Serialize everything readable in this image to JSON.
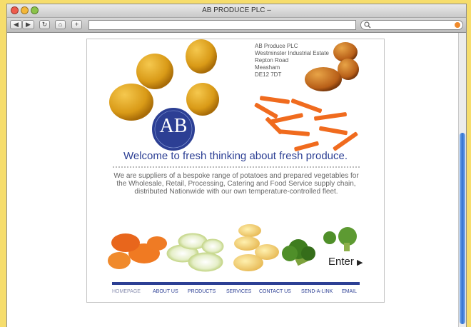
{
  "window": {
    "title": "AB PRODUCE PLC –",
    "url": "",
    "search_placeholder": ""
  },
  "toolbar": {
    "back": "◀",
    "forward": "▶",
    "reload": "↻",
    "home": "⌂",
    "add": "+",
    "search_icon": "search-icon"
  },
  "page": {
    "address": [
      "AB Produce PLC",
      "Westminster Industrial Estate",
      "Repton Road",
      "Measham",
      "DE12 7DT"
    ],
    "logo": "AB",
    "welcome": "Welcome to fresh thinking about fresh produce.",
    "description": "We are suppliers of a bespoke range of potatoes and prepared vegetables for the Wholesale, Retail, Processing, Catering and Food Service supply chain, distributed Nationwide with our own temperature-controlled fleet.",
    "enter": "Enter",
    "nav": [
      "HOMEPAGE",
      "ABOUT US",
      "PRODUCTS",
      "SERVICES",
      "CONTACT US",
      "SEND-A-LINK",
      "EMAIL"
    ]
  },
  "colors": {
    "accent": "#2c3f94",
    "background": "#f6dd6c",
    "nav_inactive": "#8a8fb0"
  }
}
